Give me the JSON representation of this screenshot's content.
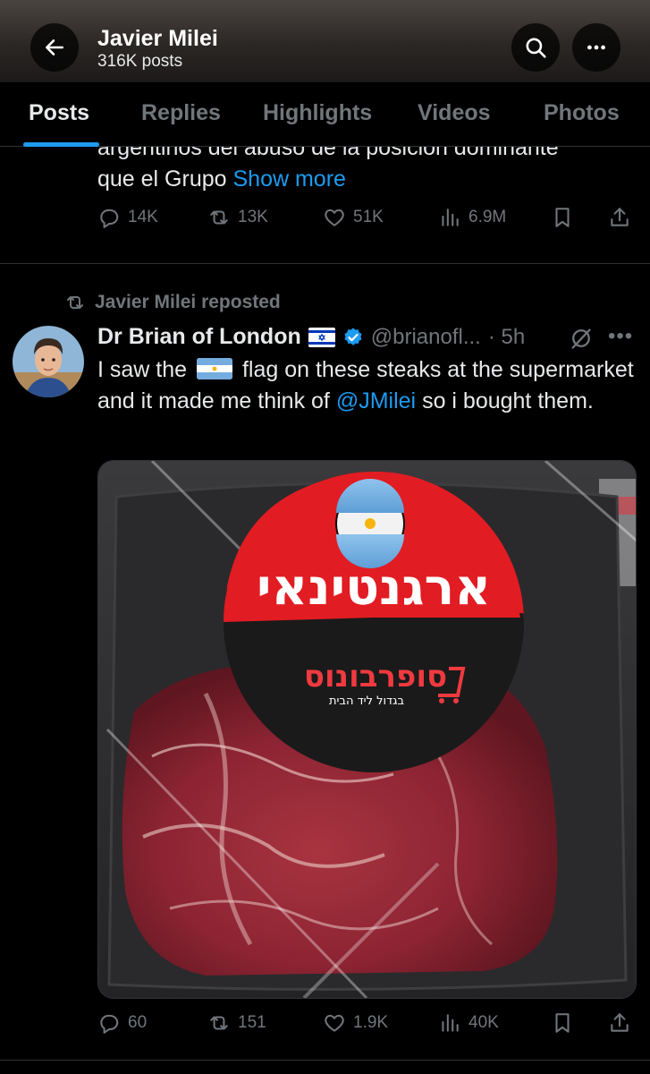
{
  "header": {
    "title": "Javier Milei",
    "subtitle": "316K posts",
    "icons": {
      "back": "arrow-left-icon",
      "search": "search-icon",
      "more": "more-horizontal-icon"
    }
  },
  "tabs": [
    {
      "label": "Posts",
      "active": true
    },
    {
      "label": "Replies",
      "active": false
    },
    {
      "label": "Highlights",
      "active": false
    },
    {
      "label": "Videos",
      "active": false
    },
    {
      "label": "Photos",
      "active": false
    }
  ],
  "tweet1": {
    "clipped_line": "argentinos del abuso de la posición dominante",
    "line2": "que el Grupo",
    "show_more": "Show more",
    "stats": {
      "replies": "14K",
      "reposts": "13K",
      "likes": "51K",
      "views": "6.9M"
    }
  },
  "tweet2": {
    "repost_label": "Javier Milei reposted",
    "author": "Dr Brian of London",
    "handle": "@brianofl...",
    "time": "· 5h",
    "text_before_flag": "I saw the",
    "text_after_flag": "flag on these steaks at the supermarket and it made me think of",
    "mention": "@JMilei",
    "text_end": "so i bought them.",
    "image": {
      "sticker_hebrew": "ארגנטינאי",
      "brand": "סופרבונוס",
      "tagline": "בגדול ליד הבית"
    },
    "stats": {
      "replies": "60",
      "reposts": "151",
      "likes": "1.9K",
      "views": "40K"
    }
  },
  "colors": {
    "accent": "#1d9bf0",
    "muted": "#71767b",
    "text": "#e7e9ea",
    "background": "#000000"
  }
}
